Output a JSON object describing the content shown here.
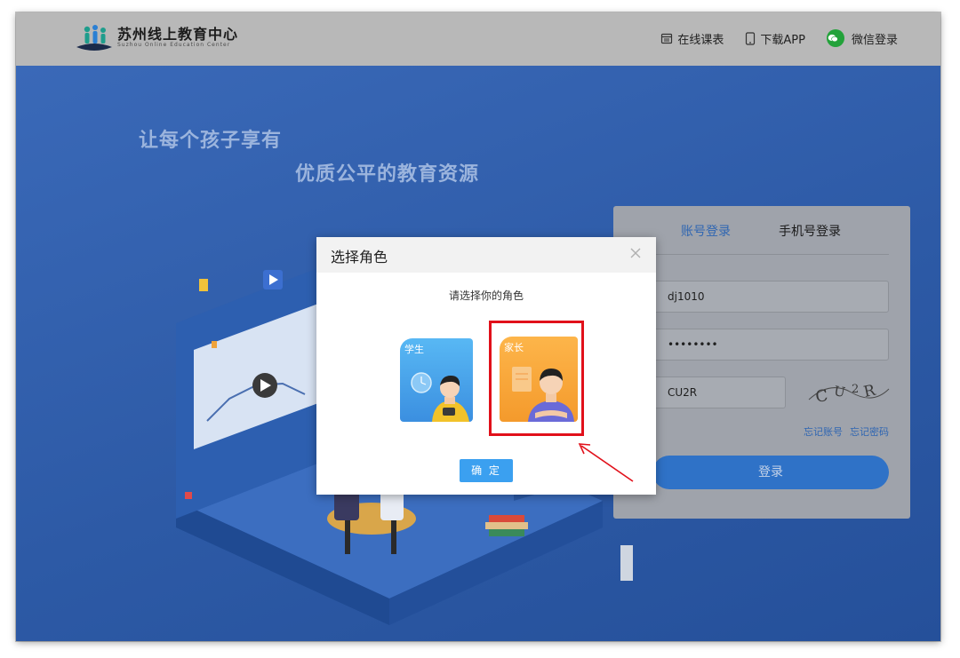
{
  "header": {
    "logo_title": "苏州线上教育中心",
    "logo_subtitle": "Suzhou Online Education Center",
    "nav": [
      {
        "label": "在线课表",
        "icon": "calendar-icon"
      },
      {
        "label": "下载APP",
        "icon": "phone-icon"
      },
      {
        "label": "微信登录",
        "icon": "wechat-icon"
      }
    ]
  },
  "hero": {
    "slogan_line1": "让每个孩子享有",
    "slogan_line2": "优质公平的教育资源"
  },
  "login": {
    "tab_account": "账号登录",
    "tab_phone": "手机号登录",
    "username_value": "dj1010",
    "password_value": "••••••••",
    "captcha_value": "CU2R",
    "captcha_image_text": "CU2R",
    "forget_account": "忘记账号",
    "forget_password": "忘记密码",
    "submit_label": "登录"
  },
  "modal": {
    "title": "选择角色",
    "prompt": "请选择你的角色",
    "roles": [
      {
        "label": "学生",
        "color": "#4aa7ef"
      },
      {
        "label": "家长",
        "color": "#f7a83a"
      }
    ],
    "confirm_label": "确 定"
  },
  "colors": {
    "hero_bg": "#2f5aa6",
    "highlight": "#e1101a",
    "confirm": "#3ba0f0",
    "wechat": "#23a23a"
  }
}
